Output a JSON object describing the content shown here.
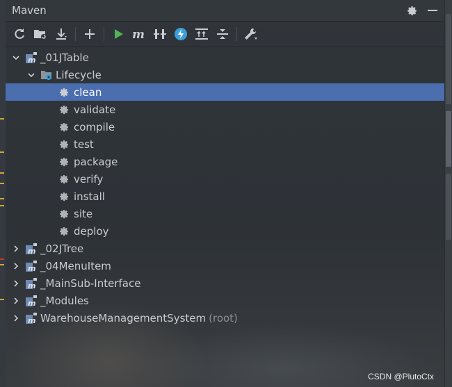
{
  "panel": {
    "title": "Maven"
  },
  "title_actions": [
    {
      "icon": "gear-icon"
    },
    {
      "icon": "minimize-icon"
    }
  ],
  "toolbar": [
    {
      "icon": "reload-icon"
    },
    {
      "icon": "generate-sources-icon"
    },
    {
      "icon": "download-icon"
    },
    {
      "icon": "add-icon"
    },
    {
      "icon": "run-icon"
    },
    {
      "icon": "execute-goal-icon"
    },
    {
      "icon": "toggle-offline-icon"
    },
    {
      "icon": "skip-tests-icon"
    },
    {
      "icon": "show-dependencies-icon"
    },
    {
      "icon": "collapse-all-icon"
    },
    {
      "icon": "settings-wrench-icon"
    }
  ],
  "tree": {
    "projects": [
      {
        "label": "_01JTable",
        "expanded": true
      },
      {
        "label": "_02JTree",
        "expanded": false
      },
      {
        "label": "_04MenuItem",
        "expanded": false
      },
      {
        "label": "_MainSub-Interface",
        "expanded": false
      },
      {
        "label": "_Modules",
        "expanded": false
      },
      {
        "label": "WarehouseManagementSystem",
        "suffix": "(root)",
        "expanded": false
      }
    ],
    "lifecycle": {
      "label": "Lifecycle",
      "expanded": true
    },
    "goals": [
      "clean",
      "validate",
      "compile",
      "test",
      "package",
      "verify",
      "install",
      "site",
      "deploy"
    ],
    "selected_goal": "clean"
  },
  "watermark": "CSDN @PlutoCtx",
  "colors": {
    "selection": "#4b6eaf",
    "run_green": "#4fb553",
    "accent_blue": "#3b9fd8"
  }
}
